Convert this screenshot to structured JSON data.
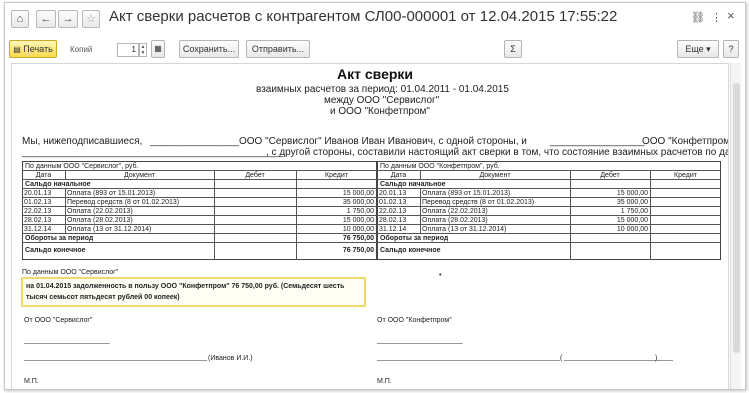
{
  "window": {
    "title": "Акт сверки расчетов с контрагентом СЛ00-000001 от 12.04.2015 17:55:22",
    "home_glyph": "⌂",
    "back_glyph": "←",
    "forward_glyph": "→",
    "link_glyph": "⛓",
    "menu_glyph": "⋮",
    "close_glyph": "×"
  },
  "toolbar": {
    "print_label": "Печать",
    "copies_label": "Копий",
    "copies_value": "1",
    "save_label": "Сохранить...",
    "send_label": "Отправить...",
    "sum_glyph": "Σ",
    "more_label": "Еще",
    "more_glyph": "▾",
    "help_glyph": "?"
  },
  "doc": {
    "title": "Акт сверки",
    "period": "взаимных расчетов за период: 01.04.2011 - 01.04.2015",
    "between": "между ООО \"Сервислог\"",
    "and": "и ООО \"Конфетпром\"",
    "intro1_a": "Мы, нижеподписавшиеся,",
    "intro1_blank": "________________",
    "intro1_b": "ООО \"Сервислог\" Иванов Иван Иванович, с одной стороны, и",
    "intro1_blank2": "_________________",
    "intro1_c": "ООО \"Конфетпром\"",
    "intro2_blank": "_______________________________________________",
    "intro2_text": ", с другой стороны, составили настоящий акт сверки в том, что состояние взаимных расчетов по данным учета следующее:",
    "left": {
      "caption": "По данным ООО \"Сервислог\", руб.",
      "headers": [
        "Дата",
        "Документ",
        "Дебет",
        "Кредит"
      ],
      "opening": "Сальдо начальное",
      "rows": [
        [
          "20.01.13",
          "Оплата (893 от 15.01.2013)",
          "",
          "15 000,00"
        ],
        [
          "01.02.13",
          "Перевод средств (8 от 01.02.2013)",
          "",
          "35 000,00"
        ],
        [
          "22.02.13",
          "Оплата (22.02.2013)",
          "",
          "1 750,00"
        ],
        [
          "28.02.13",
          "Оплата (28.02.2013)",
          "",
          "15 000,00"
        ],
        [
          "31.12.14",
          "Оплата (13 от 31.12.2014)",
          "",
          "10 000,00"
        ]
      ],
      "turnover": "Обороты за период",
      "turnover_credit": "76 750,00",
      "closing": "Сальдо конечное",
      "closing_credit": "76 750,00"
    },
    "right": {
      "caption": "По данным ООО \"Конфетпром\", руб.",
      "headers": [
        "Дата",
        "Документ",
        "Дебет",
        "Кредит"
      ],
      "opening": "Сальдо начальное",
      "rows": [
        [
          "20.01.13",
          "Оплата (893 от 15.01.2013)",
          "15 000,00",
          ""
        ],
        [
          "01.02.13",
          "Перевод средств (8 от 01.02.2013)",
          "35 000,00",
          ""
        ],
        [
          "22.02.13",
          "Оплата (22.02.2013)",
          "1 750,00",
          ""
        ],
        [
          "28.02.13",
          "Оплата (28.02.2013)",
          "15 000,00",
          ""
        ],
        [
          "31.12.14",
          "Оплата (13 от 31.12.2014)",
          "10 000,00",
          ""
        ]
      ],
      "turnover": "Обороты за период",
      "closing": "Сальдо конечное"
    },
    "debt_caption": "По данным ООО \"Сервислог\"",
    "debt_text": "на 01.04.2015 задолженность в пользу ООО \"Конфетпром\" 76 750,00 руб. (Семьдесят шесть тысяч семьсот пятьдесят рублей 00 копеек)",
    "dot": "•",
    "sign_left_from": "От ООО \"Сервислог\"",
    "sign_right_from": "От ООО \"Конфетпром\"",
    "sign_short_line": "______________________",
    "sign_long_line": "_______________________________________________",
    "sign_left_name": "(Иванов И.И.)",
    "sign_right_paren_open": "(",
    "sign_right_paren_line": "____________________________",
    "sign_right_paren_close": ")",
    "mp_left": "М.П.",
    "mp_right": "М.П."
  },
  "colors": {
    "print_button": "#f7d94c",
    "debt_box_border": "#f3d96c"
  }
}
